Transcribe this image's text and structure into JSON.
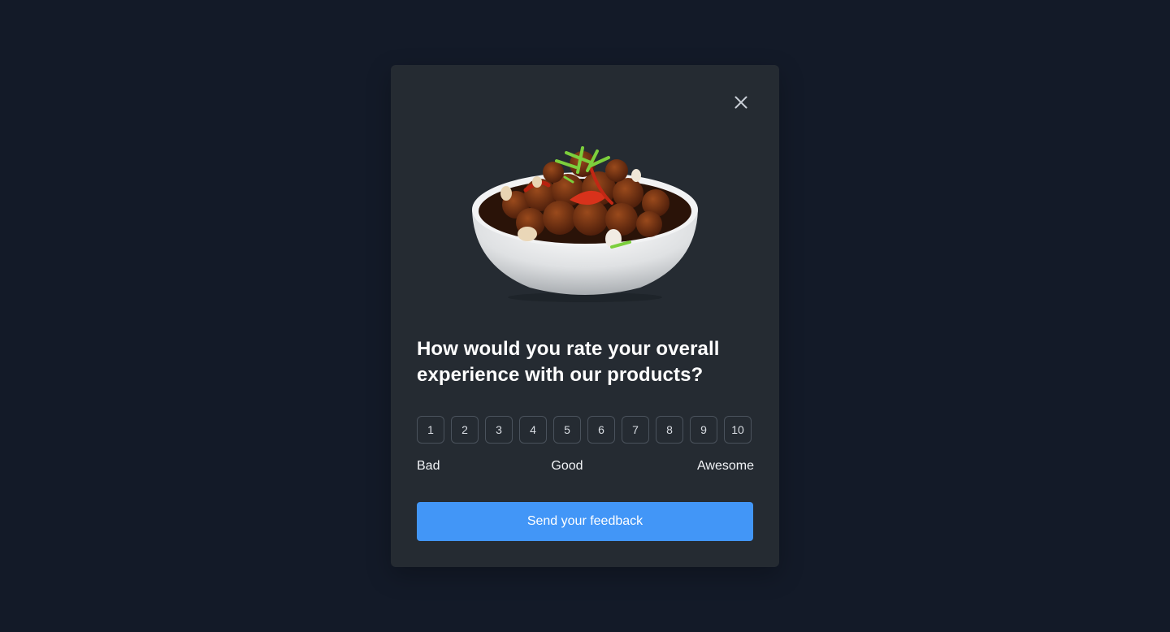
{
  "modal": {
    "close_icon": "close-icon",
    "image": "food-bowl-image",
    "question": "How would you rate your overall experience with our products?",
    "scale": [
      "1",
      "2",
      "3",
      "4",
      "5",
      "6",
      "7",
      "8",
      "9",
      "10"
    ],
    "labels": {
      "low": "Bad",
      "mid": "Good",
      "high": "Awesome"
    },
    "submit_label": "Send your feedback"
  },
  "colors": {
    "background": "#131a28",
    "card": "#252b32",
    "accent": "#4296f7",
    "border": "#4a525c"
  }
}
